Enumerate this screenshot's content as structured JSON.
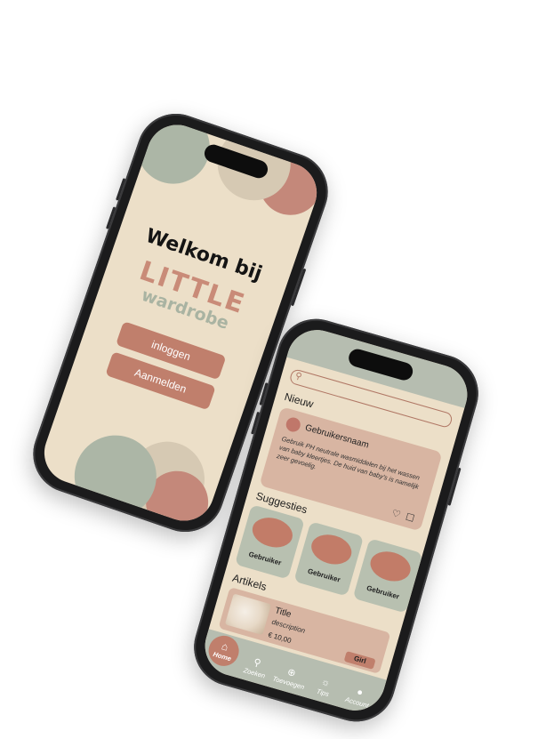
{
  "welcome": {
    "title": "Welkom bij",
    "logo_line1": "LITTLE",
    "logo_line2": "wardrobe",
    "login_label": "inloggen",
    "register_label": "Aanmelden"
  },
  "app": {
    "search": {
      "placeholder": ""
    },
    "new_section": {
      "title": "Nieuw",
      "post": {
        "username": "Gebruikersnaam",
        "text": "Gebruik PH neutrale wasmiddelen bij het wassen van baby kleertjes. De huid van baby's is namelijk zeer gevoelig."
      }
    },
    "suggestions": {
      "title": "Suggesties",
      "users": [
        "Gebruiker",
        "Gebruiker",
        "Gebruiker"
      ]
    },
    "articles": {
      "title": "Artikels",
      "item": {
        "title": "Title",
        "description": "description",
        "price": "€ 10,00",
        "tag": "Girl"
      }
    },
    "nav": {
      "home": "Home",
      "search": "Zoeken",
      "add": "Toevoegen",
      "tips": "Tips",
      "account": "Account"
    }
  },
  "colors": {
    "cream": "#ecdfc8",
    "sage": "#b6bdb0",
    "terracotta": "#c07f6c",
    "blush": "#d8b5a2"
  }
}
